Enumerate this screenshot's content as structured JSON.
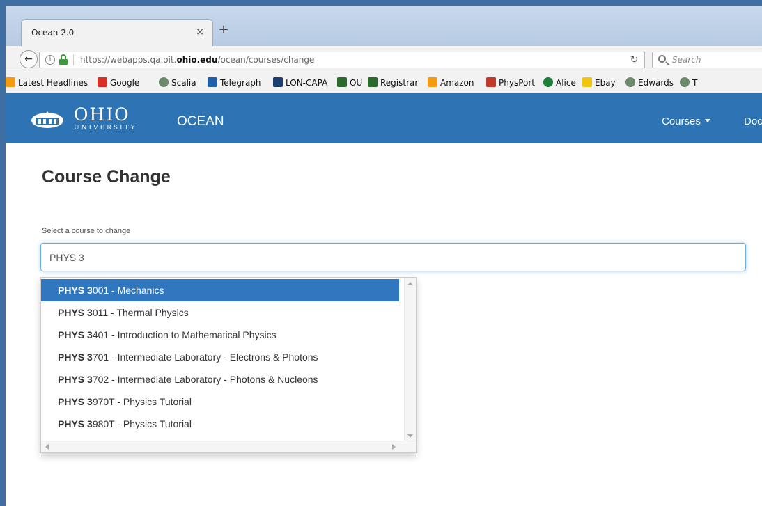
{
  "browser": {
    "tab_title": "Ocean 2.0",
    "tab_close": "×",
    "new_tab": "+",
    "url_prefix": "https://webapps.qa.oit.",
    "url_domain": "ohio.edu",
    "url_suffix": "/ocean/courses/change",
    "search_placeholder": "Search"
  },
  "bookmarks": [
    {
      "label": "Latest Headlines",
      "icon": "rss-icon",
      "color": "#f39c12"
    },
    {
      "label": "Google",
      "icon": "gmail-icon",
      "color": "#d93025"
    },
    {
      "label": "Scalia",
      "icon": "globe-icon",
      "color": "#6d8a6d"
    },
    {
      "label": "Telegraph",
      "icon": "telegraph-icon",
      "color": "#1f5fa8"
    },
    {
      "label": "LON-CAPA",
      "icon": "loncapa-icon",
      "color": "#1c3f73"
    },
    {
      "label": "OU",
      "icon": "ohio-icon",
      "color": "#2a6a2a"
    },
    {
      "label": "Registrar",
      "icon": "ohio-icon",
      "color": "#2a6a2a"
    },
    {
      "label": "Amazon",
      "icon": "amazon-icon",
      "color": "#f39c12"
    },
    {
      "label": "PhysPort",
      "icon": "physport-icon",
      "color": "#c0392b"
    },
    {
      "label": "Alice",
      "icon": "alice-icon",
      "color": "#1e7f3a"
    },
    {
      "label": "Ebay",
      "icon": "ebay-icon",
      "color": "#f1c40f"
    },
    {
      "label": "Edwards",
      "icon": "globe-icon",
      "color": "#6d8a6d"
    },
    {
      "label": "T",
      "icon": "globe-icon",
      "color": "#6d8a6d"
    }
  ],
  "header": {
    "logo_main": "OHIO",
    "logo_sub": "UNIVERSITY",
    "app_name": "OCEAN",
    "nav_courses": "Courses",
    "nav_doc": "Doc",
    "bg_color": "#2e74b5"
  },
  "page": {
    "title": "Course Change",
    "field_label": "Select a course to change",
    "input_value": "PHYS 3"
  },
  "dropdown": {
    "match_text": "PHYS 3",
    "items": [
      {
        "match": "PHYS 3",
        "rest": "001 - Mechanics",
        "active": true
      },
      {
        "match": "PHYS 3",
        "rest": "011 - Thermal Physics",
        "active": false
      },
      {
        "match": "PHYS 3",
        "rest": "401 - Introduction to Mathematical Physics",
        "active": false
      },
      {
        "match": "PHYS 3",
        "rest": "701 - Intermediate Laboratory - Electrons & Photons",
        "active": false
      },
      {
        "match": "PHYS 3",
        "rest": "702 - Intermediate Laboratory - Photons & Nucleons",
        "active": false
      },
      {
        "match": "PHYS 3",
        "rest": "970T - Physics Tutorial",
        "active": false
      },
      {
        "match": "PHYS 3",
        "rest": "980T - Physics Tutorial",
        "active": false
      }
    ],
    "active_color": "#3077c0"
  }
}
